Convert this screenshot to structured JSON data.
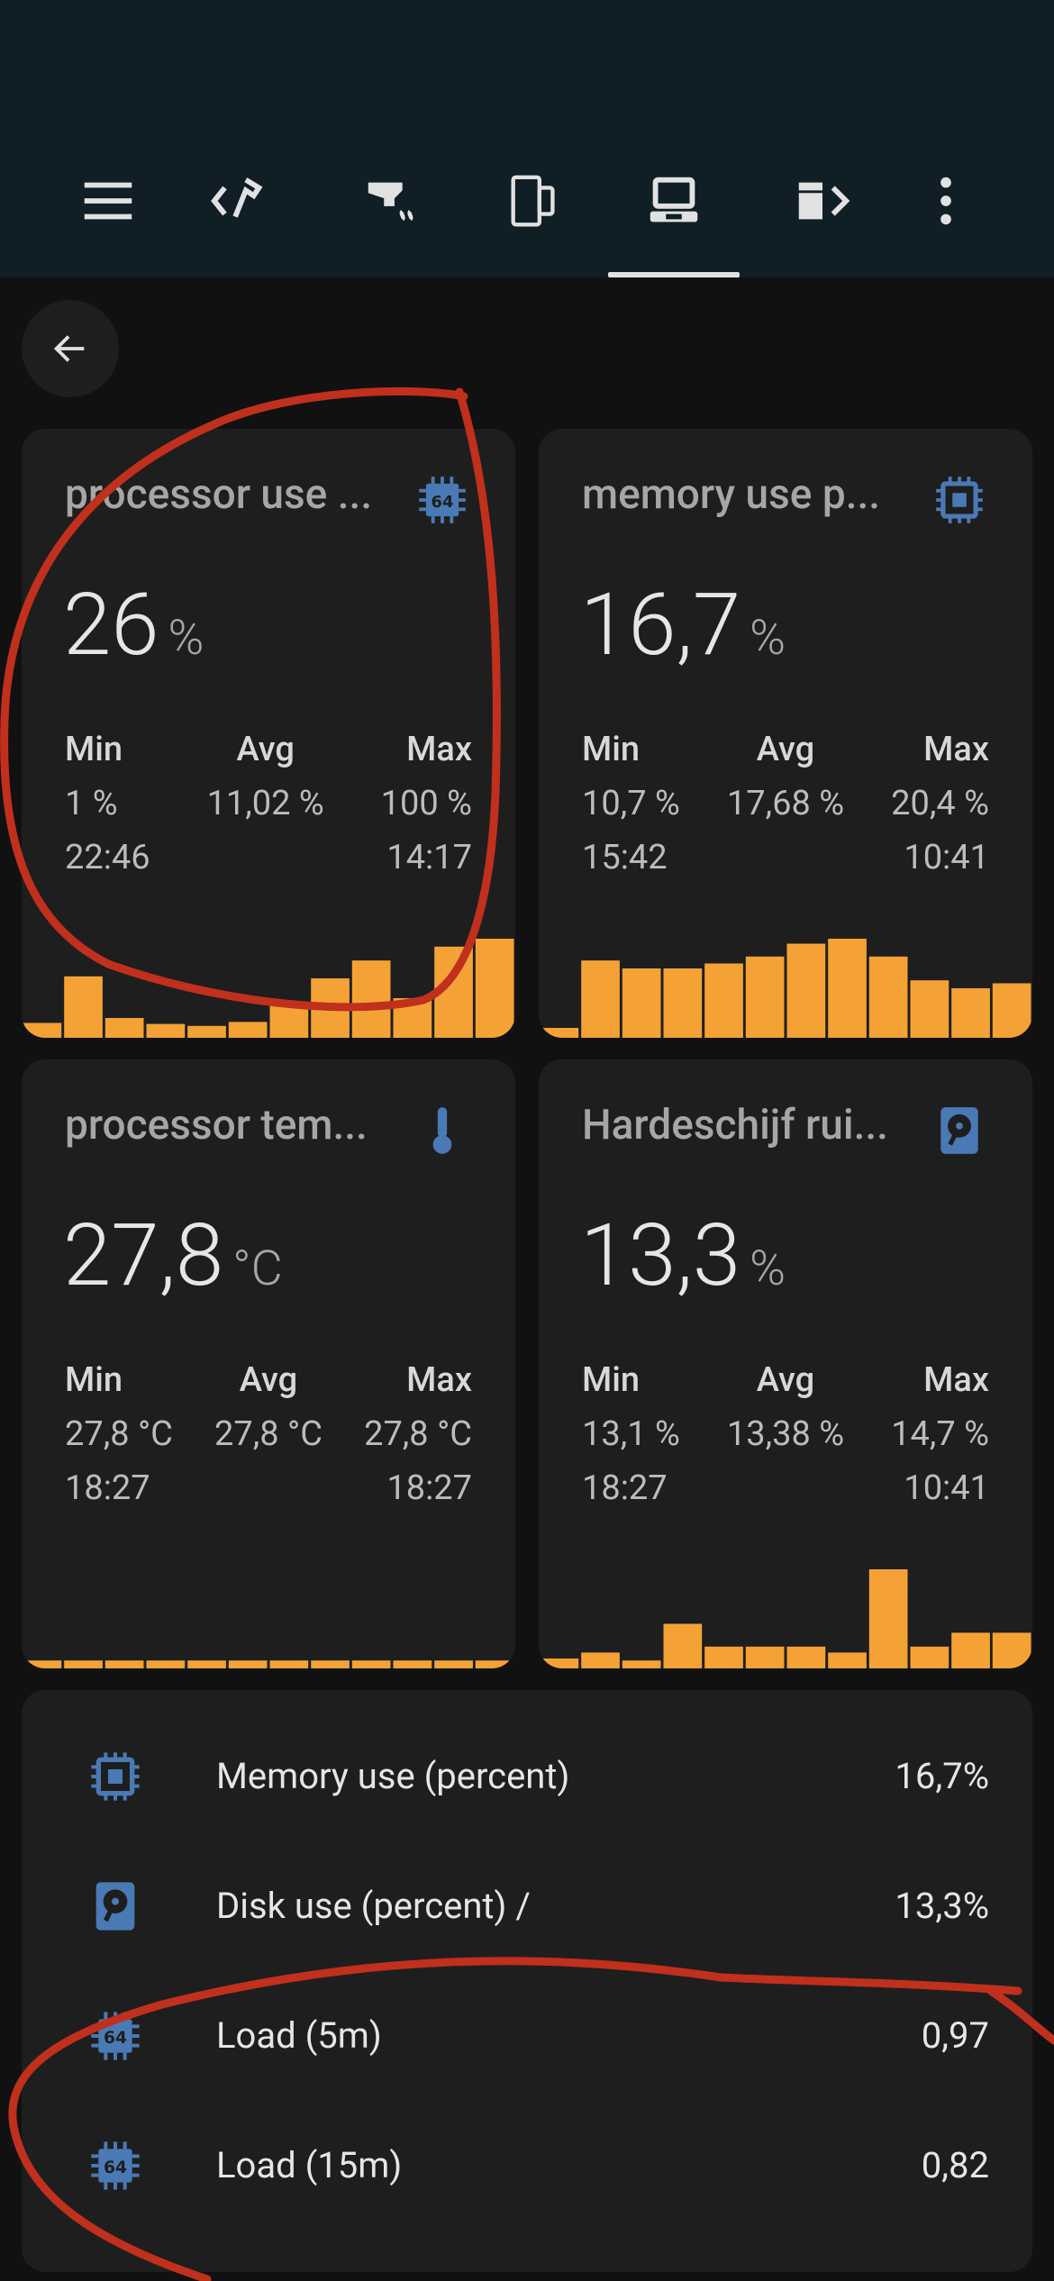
{
  "colors": {
    "accent": "#f4a235",
    "icon_blue": "#4a7ab5",
    "annotation_red": "#c0301d"
  },
  "toolbar": {
    "tabs": [
      {
        "icon": "menu-icon"
      },
      {
        "icon": "chevron-left-hammer-icon"
      },
      {
        "icon": "faucet-icon"
      },
      {
        "icon": "door-window-icon"
      },
      {
        "icon": "laptop-icon",
        "selected": true
      },
      {
        "icon": "server-chevron-right-icon"
      },
      {
        "icon": "more-vertical-icon"
      }
    ]
  },
  "cards": [
    {
      "title": "processor use ...",
      "icon": "cpu-64-icon",
      "value": "26",
      "unit": "%",
      "min_label": "Min",
      "avg_label": "Avg",
      "max_label": "Max",
      "min": "1 %",
      "avg": "11,02 %",
      "max": "100 %",
      "min_time": "22:46",
      "max_time": "14:17",
      "history": [
        0.15,
        0.62,
        0.2,
        0.14,
        0.12,
        0.16,
        0.35,
        0.6,
        0.78,
        0.4,
        0.92,
        1.0
      ]
    },
    {
      "title": "memory use p...",
      "icon": "chip-icon",
      "value": "16,7",
      "unit": "%",
      "min_label": "Min",
      "avg_label": "Avg",
      "max_label": "Max",
      "min": "10,7 %",
      "avg": "17,68 %",
      "max": "20,4 %",
      "min_time": "15:42",
      "max_time": "10:41",
      "history": [
        0.1,
        0.78,
        0.7,
        0.7,
        0.75,
        0.82,
        0.95,
        1.0,
        0.82,
        0.58,
        0.5,
        0.55
      ]
    },
    {
      "title": "processor tem...",
      "icon": "thermometer-icon",
      "value": "27,8",
      "unit": "°C",
      "min_label": "Min",
      "avg_label": "Avg",
      "max_label": "Max",
      "min": "27,8 °C",
      "avg": "27,8 °C",
      "max": "27,8 °C",
      "min_time": "18:27",
      "max_time": "18:27",
      "history": [
        0.08,
        0.08,
        0.08,
        0.08,
        0.08,
        0.08,
        0.08,
        0.08,
        0.08,
        0.08,
        0.08,
        0.08
      ]
    },
    {
      "title": "Hardeschijf rui...",
      "icon": "harddisk-icon",
      "value": "13,3",
      "unit": "%",
      "min_label": "Min",
      "avg_label": "Avg",
      "max_label": "Max",
      "min": "13,1 %",
      "avg": "13,38 %",
      "max": "14,7 %",
      "min_time": "18:27",
      "max_time": "10:41",
      "history": [
        0.1,
        0.16,
        0.08,
        0.45,
        0.22,
        0.22,
        0.22,
        0.16,
        1.0,
        0.22,
        0.36,
        0.36
      ]
    }
  ],
  "entities": [
    {
      "icon": "chip-icon",
      "label": "Memory use (percent)",
      "value": "16,7%"
    },
    {
      "icon": "harddisk-icon",
      "label": "Disk use (percent) /",
      "value": "13,3%"
    },
    {
      "icon": "cpu-64-icon",
      "label": "Load (5m)",
      "value": "0,97"
    },
    {
      "icon": "cpu-64-icon",
      "label": "Load (15m)",
      "value": "0,82"
    }
  ]
}
